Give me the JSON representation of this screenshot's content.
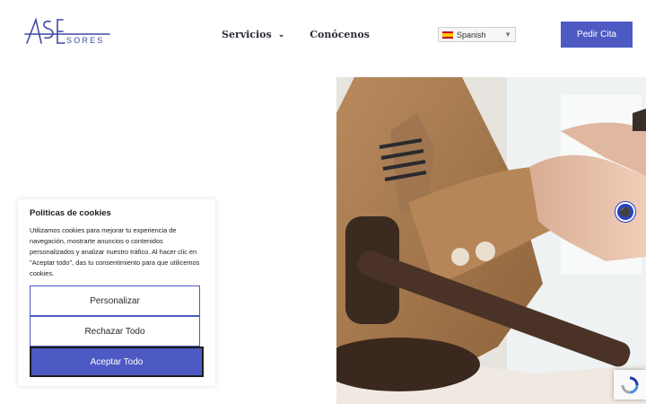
{
  "header": {
    "logo_text": "ASESORES",
    "nav": [
      {
        "label": "Servicios",
        "has_dropdown": true,
        "icon": "chevron-down-icon"
      },
      {
        "label": "Conócenos",
        "has_dropdown": false
      }
    ],
    "language": {
      "selected": "Spanish",
      "flag_icon": "spain-flag-icon"
    },
    "cta_label": "Pedir Cita"
  },
  "cookie_banner": {
    "title": "Politicas de cookies",
    "body": "Utilizamos cookies para mejorar tu experiencia de navegación, mostrarte anuncios o contenidos personalizados y analizar nuestro tráfico. Al hacer clic en \"Aceptar todo\", das tu consentimiento para que utilicemos cookies.",
    "buttons": {
      "customize": "Personalizar",
      "reject": "Rechazar Todo",
      "accept": "Aceptar Todo"
    }
  },
  "widgets": {
    "accessibility_icon": "accessibility-icon",
    "recaptcha_icon": "recaptcha-icon"
  },
  "colors": {
    "brand": "#4d5ac3",
    "accessibility": "#2240c9"
  }
}
